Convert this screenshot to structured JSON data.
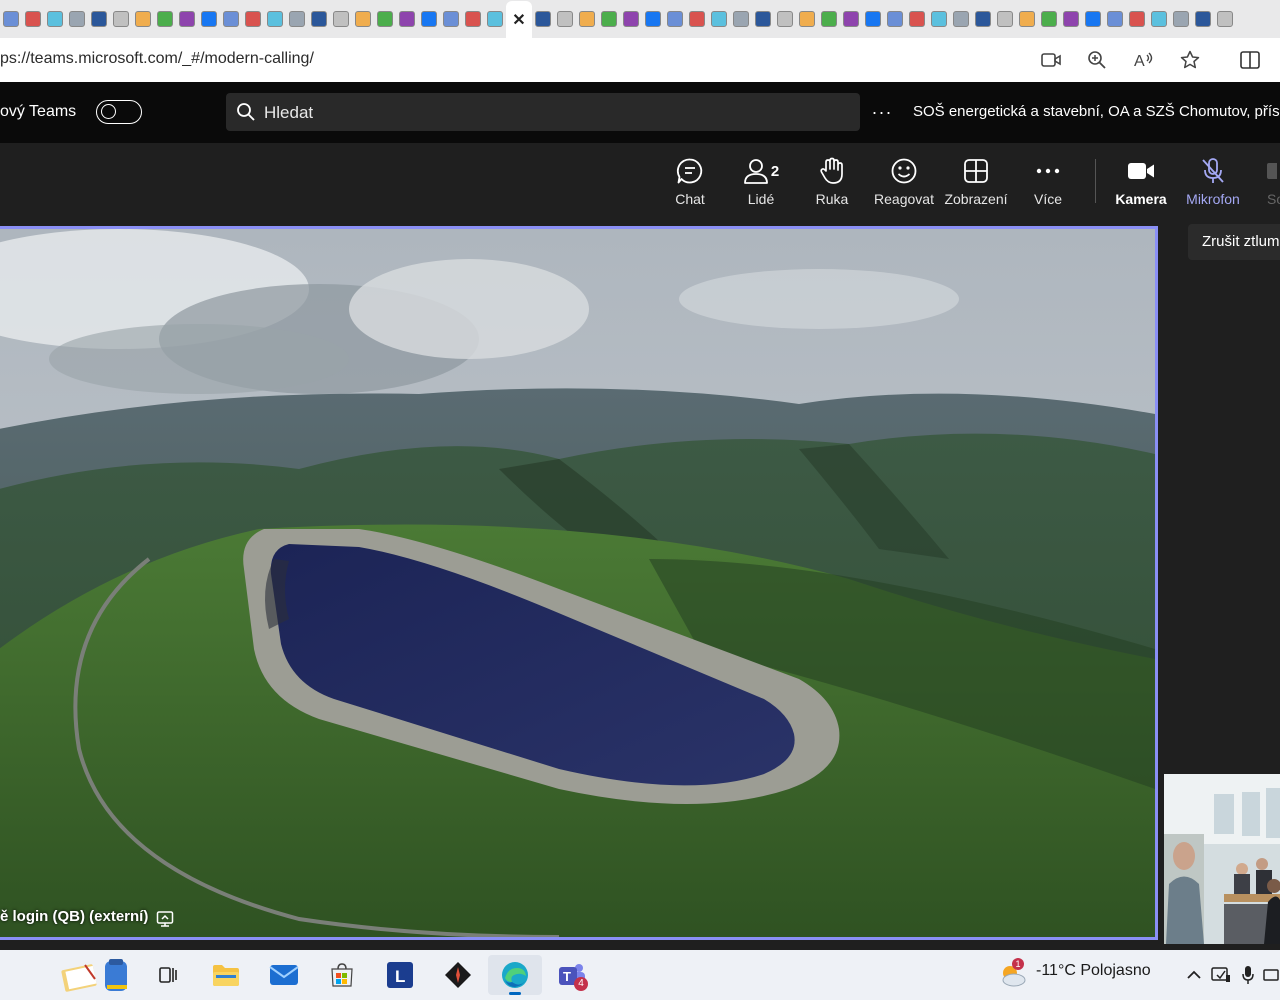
{
  "browser": {
    "url": "ps://teams.microsoft.com/_#/modern-calling/",
    "tab_icons": [
      "tab-favicon"
    ],
    "active_tab_close": "✕"
  },
  "teams_header": {
    "app_label": "ový Teams",
    "search_placeholder": "Hledat",
    "more_label": "···",
    "org_name": "SOŠ energetická a stavební, OA a SZŠ Chomutov, přísp"
  },
  "toolbar": {
    "chat": "Chat",
    "people": "Lidé",
    "people_count": "2",
    "hand": "Ruka",
    "react": "Reagovat",
    "view": "Zobrazení",
    "more": "Více",
    "camera": "Kamera",
    "mic": "Mikrofon",
    "share": "So"
  },
  "tooltip": {
    "text": "Zrušit ztlum"
  },
  "stage": {
    "participant_name": "ě login (QB) (externí)"
  },
  "taskbar": {
    "teams_badge": "4",
    "weather_badge": "1",
    "weather_text": "-11°C  Polojasno"
  },
  "colors": {
    "accent": "#8a8ff5",
    "mic_active": "#a4a8f3",
    "teams_bg": "#0a0a0a",
    "toolbar_bg": "#1f1f1f"
  }
}
